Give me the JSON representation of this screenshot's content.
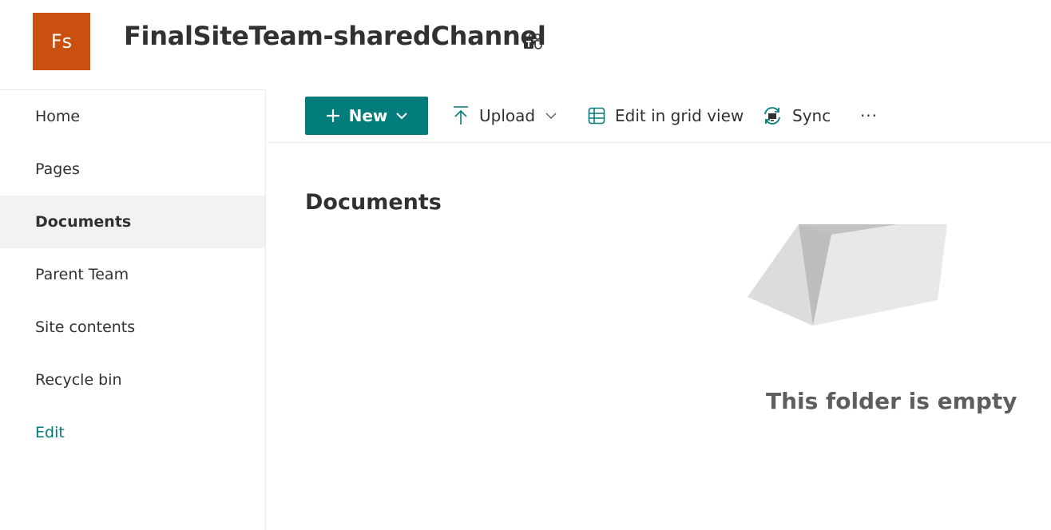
{
  "header": {
    "logo_initials": "Fs",
    "site_title": "FinalSiteTeam-sharedChannel",
    "teams_icon": "teams-icon",
    "logo_color": "#ca5010"
  },
  "sidebar": {
    "items": [
      {
        "label": "Home"
      },
      {
        "label": "Pages"
      },
      {
        "label": "Documents",
        "selected": true
      },
      {
        "label": "Parent Team"
      },
      {
        "label": "Site contents"
      },
      {
        "label": "Recycle bin"
      }
    ],
    "edit_label": "Edit"
  },
  "command_bar": {
    "new_label": "New",
    "upload_label": "Upload",
    "grid_label": "Edit in grid view",
    "sync_label": "Sync",
    "more_label": "···"
  },
  "main": {
    "title": "Documents",
    "empty_message": "This folder is empty"
  },
  "colors": {
    "accent": "#037c7c",
    "selected_nav_bg": "#f3f2f1",
    "link": "#03787c"
  }
}
